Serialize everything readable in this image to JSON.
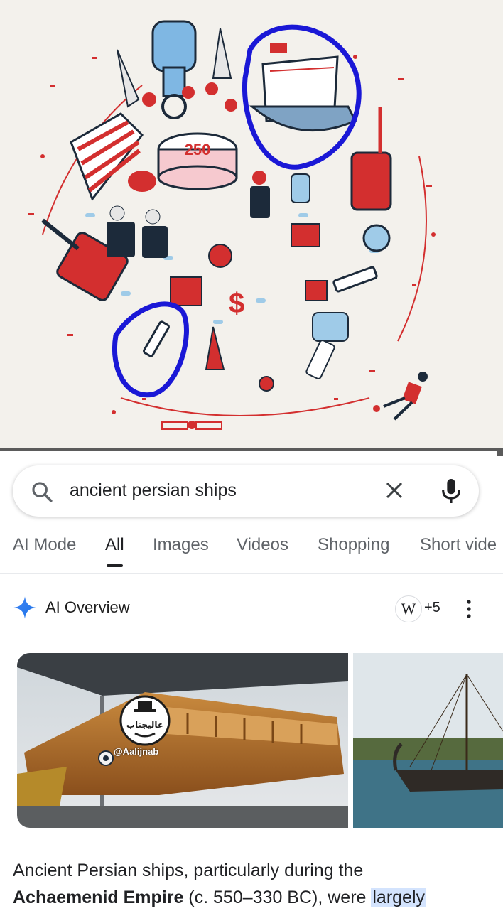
{
  "illustration": {
    "cake_text": "250",
    "description_colors": {
      "red": "#d32f2f",
      "ink": "#1c2a3a",
      "blue_marker": "#1a18d6",
      "light_blue": "#9fcbe8"
    }
  },
  "search": {
    "query": "ancient persian ships",
    "icons": {
      "left": "search-icon",
      "clear": "close-icon",
      "voice": "mic-icon"
    }
  },
  "tabs": [
    {
      "label": "AI Mode",
      "active": false
    },
    {
      "label": "All",
      "active": true
    },
    {
      "label": "Images",
      "active": false
    },
    {
      "label": "Videos",
      "active": false
    },
    {
      "label": "Shopping",
      "active": false
    },
    {
      "label": "Short vide",
      "active": false
    }
  ],
  "ai_overview": {
    "title": "AI Overview",
    "source_icon": "W",
    "source_count": "+5"
  },
  "watermark": {
    "logo_text": "عالیجناب",
    "handle": "@Aalijnab"
  },
  "answer": {
    "line1": "Ancient Persian ships, particularly during the",
    "bold": "Achaemenid Empire",
    "rest": " (c. 550–330 BC), were ",
    "highlight": "largely"
  }
}
